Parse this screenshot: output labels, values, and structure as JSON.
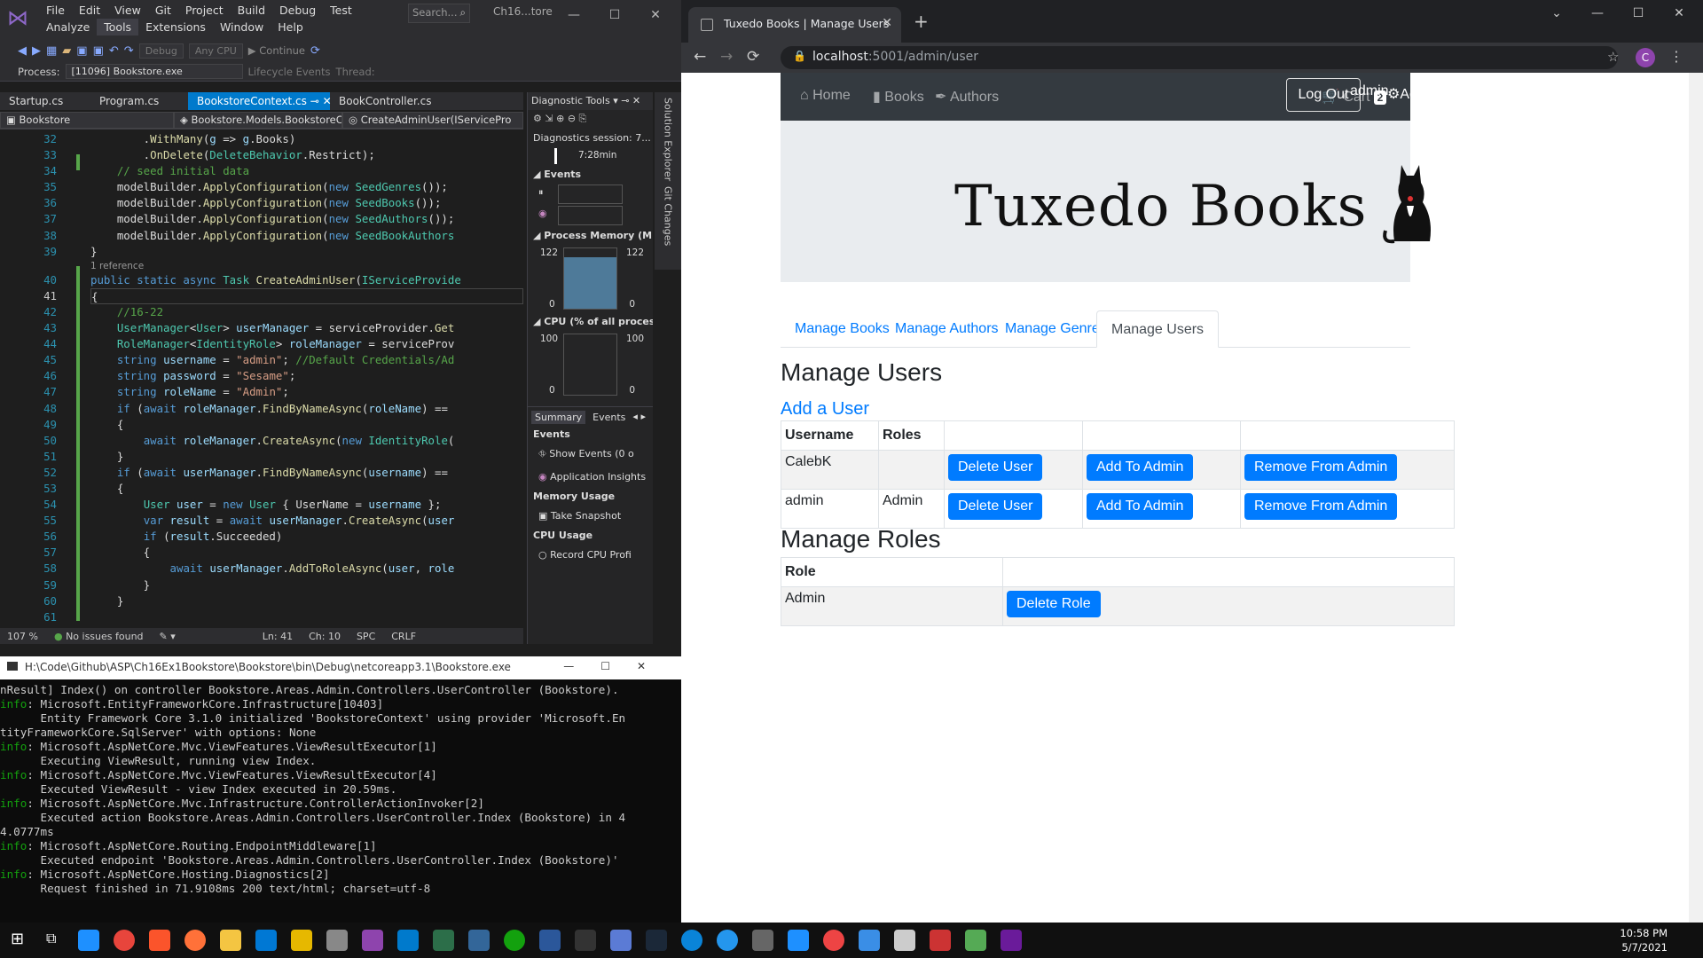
{
  "vs": {
    "menu": [
      "File",
      "Edit",
      "View",
      "Git",
      "Project",
      "Build",
      "Debug",
      "Test",
      "Analyze",
      "Tools",
      "Extensions",
      "Window",
      "Help"
    ],
    "search_placeholder": "Search...",
    "title": "Ch16...tore",
    "toolbar": {
      "config": "Debug",
      "platform": "Any CPU",
      "continue": "Continue"
    },
    "process_label": "Process:",
    "process_value": "[11096] Bookstore.exe",
    "lifecycle": "Lifecycle Events",
    "thread": "Thread:",
    "tabs": [
      "Startup.cs",
      "Program.cs",
      "BookstoreContext.cs",
      "BookController.cs"
    ],
    "nav": {
      "project": "Bookstore",
      "class": "Bookstore.Models.BookstoreC",
      "member": "CreateAdminUser(IServicePro"
    },
    "reference_label": "1 reference",
    "line_numbers": [
      "32",
      "33",
      "34",
      "35",
      "36",
      "37",
      "38",
      "39",
      "40",
      "41",
      "42",
      "43",
      "44",
      "45",
      "46",
      "47",
      "48",
      "49",
      "50",
      "51",
      "52",
      "53",
      "54",
      "55",
      "56",
      "57",
      "58",
      "59",
      "60",
      "61"
    ],
    "status": {
      "zoom": "107 %",
      "issues": "No issues found",
      "ln": "Ln: 41",
      "ch": "Ch: 10",
      "spc": "SPC",
      "crlf": "CRLF"
    },
    "side_panels": [
      "Solution Explorer",
      "Git Changes"
    ]
  },
  "diag": {
    "title": "Diagnostic Tools",
    "session": "Diagnostics session: 7...",
    "time": "7:28min",
    "events": "Events",
    "memory_title": "Process Memory (MB)",
    "memory_max_left": "122",
    "memory_max_right": "122",
    "memory_min_left": "0",
    "memory_min_right": "0",
    "cpu_title": "CPU (% of all processo",
    "cpu_max_left": "100",
    "cpu_max_right": "100",
    "cpu_min_left": "0",
    "cpu_min_right": "0",
    "tab_summary": "Summary",
    "tab_events": "Events",
    "events_section": "Events",
    "show_events": "Show Events (0 o",
    "app_insights": "Application Insights",
    "memory_usage": "Memory Usage",
    "take_snapshot": "Take Snapshot",
    "cpu_usage": "CPU Usage",
    "record_cpu": "Record CPU Profi"
  },
  "console": {
    "title": "H:\\Code\\Github\\ASP\\Ch16Ex1Bookstore\\Bookstore\\bin\\Debug\\netcoreapp3.1\\Bookstore.exe",
    "lines": [
      {
        "p": "",
        "t": "nResult] Index() on controller Bookstore.Areas.Admin.Controllers.UserController (Bookstore)."
      },
      {
        "p": "info",
        "t": ": Microsoft.EntityFrameworkCore.Infrastructure[10403]"
      },
      {
        "p": "",
        "t": "      Entity Framework Core 3.1.0 initialized 'BookstoreContext' using provider 'Microsoft.En"
      },
      {
        "p": "",
        "t": "tityFrameworkCore.SqlServer' with options: None"
      },
      {
        "p": "info",
        "t": ": Microsoft.AspNetCore.Mvc.ViewFeatures.ViewResultExecutor[1]"
      },
      {
        "p": "",
        "t": "      Executing ViewResult, running view Index."
      },
      {
        "p": "info",
        "t": ": Microsoft.AspNetCore.Mvc.ViewFeatures.ViewResultExecutor[4]"
      },
      {
        "p": "",
        "t": "      Executed ViewResult - view Index executed in 20.59ms."
      },
      {
        "p": "info",
        "t": ": Microsoft.AspNetCore.Mvc.Infrastructure.ControllerActionInvoker[2]"
      },
      {
        "p": "",
        "t": "      Executed action Bookstore.Areas.Admin.Controllers.UserController.Index (Bookstore) in 4"
      },
      {
        "p": "",
        "t": "4.0777ms"
      },
      {
        "p": "info",
        "t": ": Microsoft.AspNetCore.Routing.EndpointMiddleware[1]"
      },
      {
        "p": "",
        "t": "      Executed endpoint 'Bookstore.Areas.Admin.Controllers.UserController.Index (Bookstore)'"
      },
      {
        "p": "info",
        "t": ": Microsoft.AspNetCore.Hosting.Diagnostics[2]"
      },
      {
        "p": "",
        "t": "      Request finished in 71.9108ms 200 text/html; charset=utf-8"
      }
    ]
  },
  "browser": {
    "tab_title": "Tuxedo Books | Manage Users",
    "url_host": "localhost",
    "url_rest": ":5001/admin/user",
    "profile_initial": "C"
  },
  "site": {
    "nav_home": "Home",
    "nav_books": "Books",
    "nav_authors": "Authors",
    "cart_label": "Cart",
    "cart_count": "2",
    "logout": "Log Out",
    "user": "admin",
    "admin_link": "Admin",
    "logo": "Tuxedo Books",
    "tabs": [
      "Manage Books",
      "Manage Authors",
      "Manage Genres",
      "Manage Users"
    ],
    "heading_users": "Manage Users",
    "add_user": "Add a User",
    "user_headers": [
      "Username",
      "Roles"
    ],
    "users": [
      {
        "username": "CalebK",
        "roles": ""
      },
      {
        "username": "admin",
        "roles": "Admin"
      }
    ],
    "btn_delete_user": "Delete User",
    "btn_add_admin": "Add To Admin",
    "btn_remove_admin": "Remove From Admin",
    "heading_roles": "Manage Roles",
    "role_header": "Role",
    "roles": [
      {
        "name": "Admin"
      }
    ],
    "btn_delete_role": "Delete Role"
  },
  "taskbar": {
    "time": "10:58 PM",
    "date": "5/7/2021"
  }
}
